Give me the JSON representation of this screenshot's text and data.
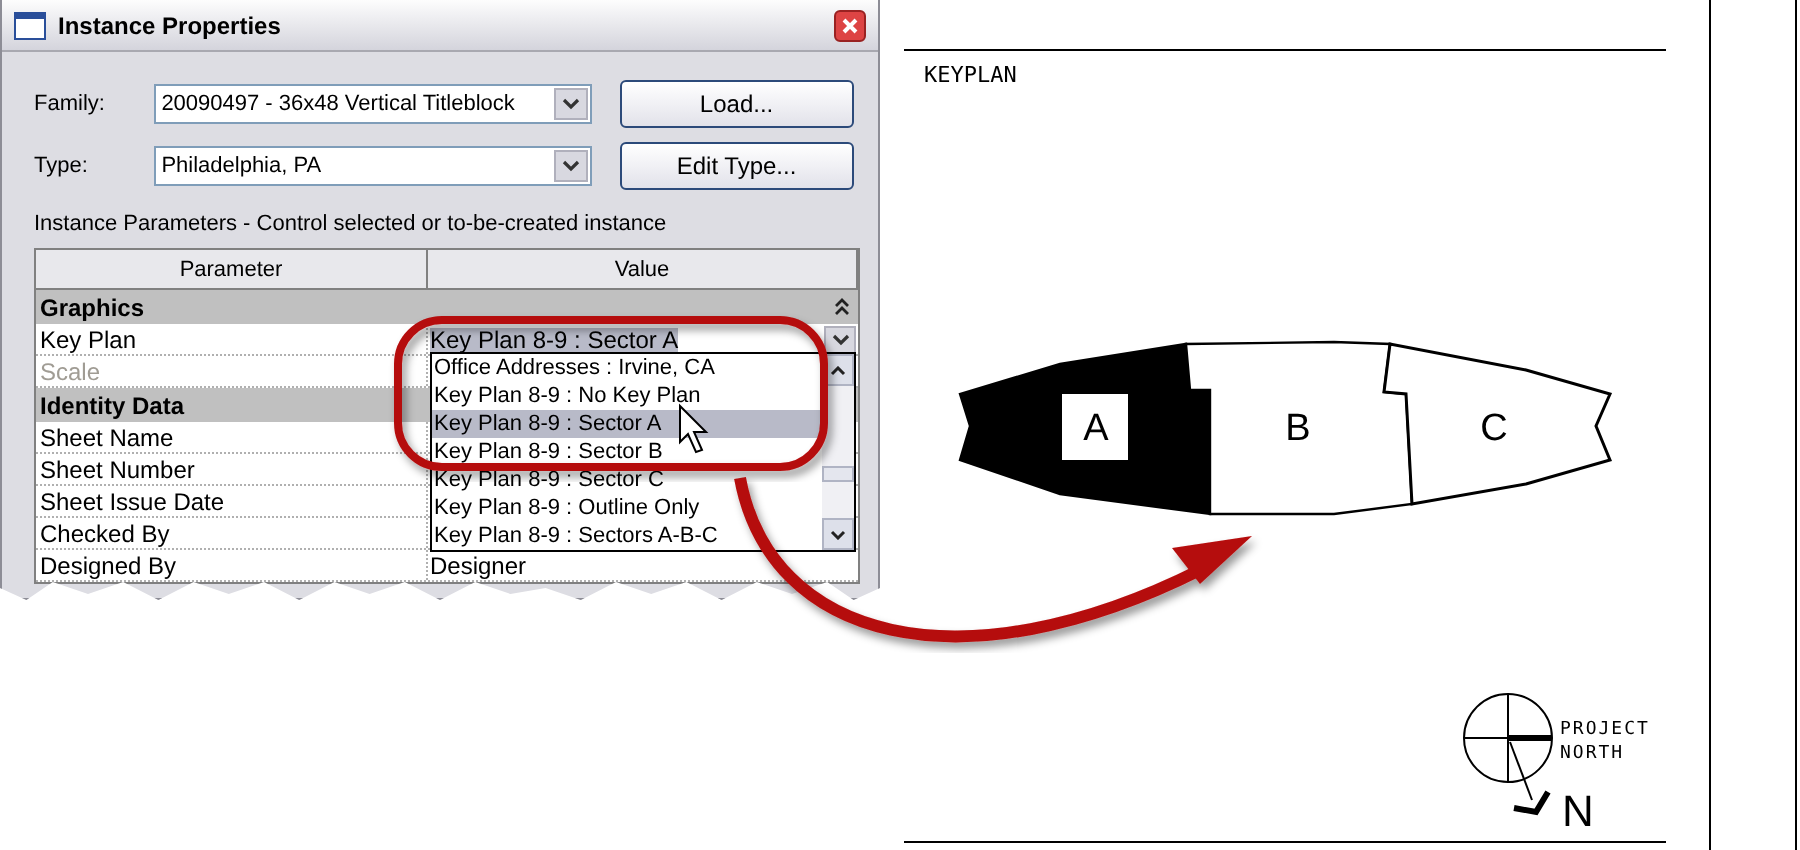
{
  "window": {
    "title": "Instance Properties"
  },
  "fields": [
    {
      "label": "Family:",
      "value": "20090497 - 36x48 Vertical Titleblock",
      "button": "Load..."
    },
    {
      "label": "Type:",
      "value": "Philadelphia, PA",
      "button": "Edit Type..."
    }
  ],
  "caption": "Instance Parameters - Control selected or to-be-created instance",
  "table": {
    "columns": [
      "Parameter",
      "Value"
    ],
    "groups": [
      {
        "name": "Graphics",
        "expanded": true,
        "rows": [
          {
            "name": "Key Plan",
            "value": "Key Plan 8-9 : Sector A",
            "kind": "combo",
            "disabled": false
          },
          {
            "name": "Scale",
            "kind": "text",
            "disabled": true
          }
        ]
      },
      {
        "name": "Identity Data",
        "rows": [
          {
            "name": "Sheet Name",
            "kind": "text",
            "disabled": false
          },
          {
            "name": "Sheet Number",
            "kind": "text",
            "disabled": false
          },
          {
            "name": "Sheet Issue Date",
            "kind": "text",
            "disabled": false
          },
          {
            "name": "Checked By",
            "kind": "text",
            "disabled": false
          },
          {
            "name": "Designed By",
            "value": "Designer",
            "kind": "text",
            "disabled": false
          }
        ]
      }
    ]
  },
  "dropdown": {
    "items": [
      {
        "label": "Office Addresses : Irvine, CA",
        "selected": false
      },
      {
        "label": "Key Plan 8-9 : No Key Plan",
        "selected": false
      },
      {
        "label": "Key Plan 8-9 : Sector A",
        "selected": true
      },
      {
        "label": "Key Plan 8-9 : Sector B",
        "selected": false
      },
      {
        "label": "Key Plan 8-9 : Sector C",
        "selected": false
      },
      {
        "label": "Key Plan 8-9 : Outline Only",
        "selected": false
      },
      {
        "label": "Key Plan 8-9 : Sectors A-B-C",
        "selected": false
      }
    ]
  },
  "sheet": {
    "title": "KEYPLAN",
    "sectors": [
      {
        "label": "A",
        "selected": true
      },
      {
        "label": "B",
        "selected": false
      },
      {
        "label": "C",
        "selected": false
      }
    ],
    "north": {
      "label_lines": [
        "PROJECT",
        "NORTH"
      ],
      "letter": "N"
    }
  }
}
